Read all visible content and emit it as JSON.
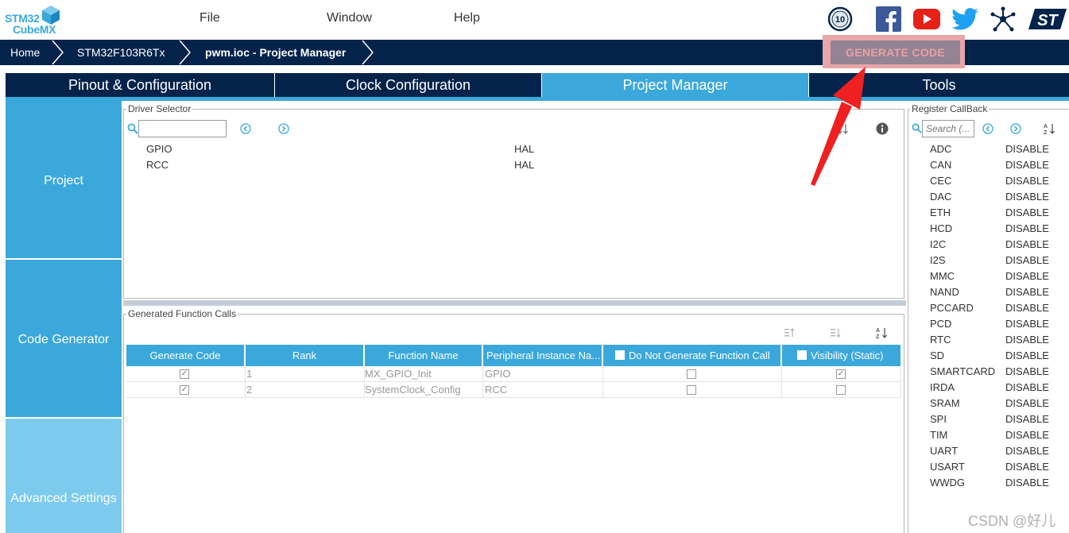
{
  "app": {
    "logo_line1": "STM32",
    "logo_line2": "CubeMX",
    "brand_color": "#3aa8dc",
    "nav_color": "#03234b"
  },
  "menu": [
    "File",
    "Window",
    "Help"
  ],
  "social_icons": [
    "anniversary-badge-icon",
    "facebook-icon",
    "youtube-icon",
    "twitter-icon",
    "network-icon",
    "st-logo-icon"
  ],
  "breadcrumb": [
    "Home",
    "STM32F103R6Tx",
    "pwm.ioc - Project Manager"
  ],
  "generate_button": "GENERATE CODE",
  "tabs": [
    "Pinout & Configuration",
    "Clock Configuration",
    "Project Manager",
    "Tools"
  ],
  "active_tab": "Project Manager",
  "sidenav": [
    "Project",
    "Code Generator",
    "Advanced Settings"
  ],
  "driver_selector": {
    "title": "Driver Selector",
    "search_value": "",
    "rows": [
      {
        "name": "GPIO",
        "driver": "HAL"
      },
      {
        "name": "RCC",
        "driver": "HAL"
      }
    ]
  },
  "generated_calls": {
    "title": "Generated Function Calls",
    "columns": [
      "Generate Code",
      "Rank",
      "Function Name",
      "Peripheral Instance Na...",
      "Do Not Generate Function Call",
      "Visibility (Static)"
    ],
    "rows": [
      {
        "generate": true,
        "rank": "1",
        "function": "MX_GPIO_Init",
        "instance": "GPIO",
        "do_not_generate": false,
        "visibility": true
      },
      {
        "generate": true,
        "rank": "2",
        "function": "SystemClock_Config",
        "instance": "RCC",
        "do_not_generate": false,
        "visibility": false
      }
    ]
  },
  "register_callback": {
    "title": "Register CallBack",
    "search_placeholder": "Search (...",
    "items": [
      {
        "name": "ADC",
        "value": "DISABLE"
      },
      {
        "name": "CAN",
        "value": "DISABLE"
      },
      {
        "name": "CEC",
        "value": "DISABLE"
      },
      {
        "name": "DAC",
        "value": "DISABLE"
      },
      {
        "name": "ETH",
        "value": "DISABLE"
      },
      {
        "name": "HCD",
        "value": "DISABLE"
      },
      {
        "name": "I2C",
        "value": "DISABLE"
      },
      {
        "name": "I2S",
        "value": "DISABLE"
      },
      {
        "name": "MMC",
        "value": "DISABLE"
      },
      {
        "name": "NAND",
        "value": "DISABLE"
      },
      {
        "name": "PCCARD",
        "value": "DISABLE"
      },
      {
        "name": "PCD",
        "value": "DISABLE"
      },
      {
        "name": "RTC",
        "value": "DISABLE"
      },
      {
        "name": "SD",
        "value": "DISABLE"
      },
      {
        "name": "SMARTCARD",
        "value": "DISABLE"
      },
      {
        "name": "IRDA",
        "value": "DISABLE"
      },
      {
        "name": "SRAM",
        "value": "DISABLE"
      },
      {
        "name": "SPI",
        "value": "DISABLE"
      },
      {
        "name": "TIM",
        "value": "DISABLE"
      },
      {
        "name": "UART",
        "value": "DISABLE"
      },
      {
        "name": "USART",
        "value": "DISABLE"
      },
      {
        "name": "WWDG",
        "value": "DISABLE"
      }
    ]
  },
  "watermark": "CSDN @好儿"
}
